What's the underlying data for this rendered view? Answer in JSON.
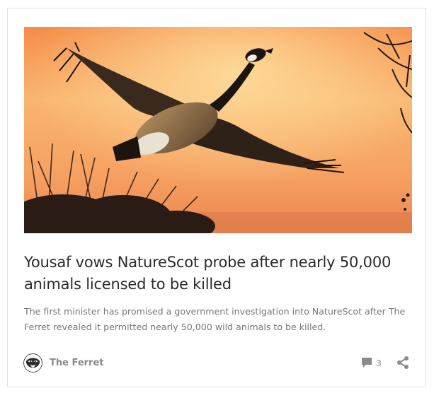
{
  "article": {
    "image_alt": "Canada goose flying against an orange sunset sky",
    "title": "Yousaf vows NatureScot probe after nearly 50,000 animals licensed to be killed",
    "excerpt": "The first minister has promised a government investigation into NatureScot after The Ferret revealed it permitted nearly 50,000 wild animals to be killed.",
    "author": "The Ferret",
    "comment_count": "3"
  },
  "icons": {
    "author_avatar": "ferret-logo-icon",
    "comments": "speech-bubble-icon",
    "share": "share-icon"
  },
  "colors": {
    "title": "#2b2b2b",
    "excerpt": "#787878",
    "meta": "#8a8a8a",
    "border": "#e1e1e1"
  }
}
